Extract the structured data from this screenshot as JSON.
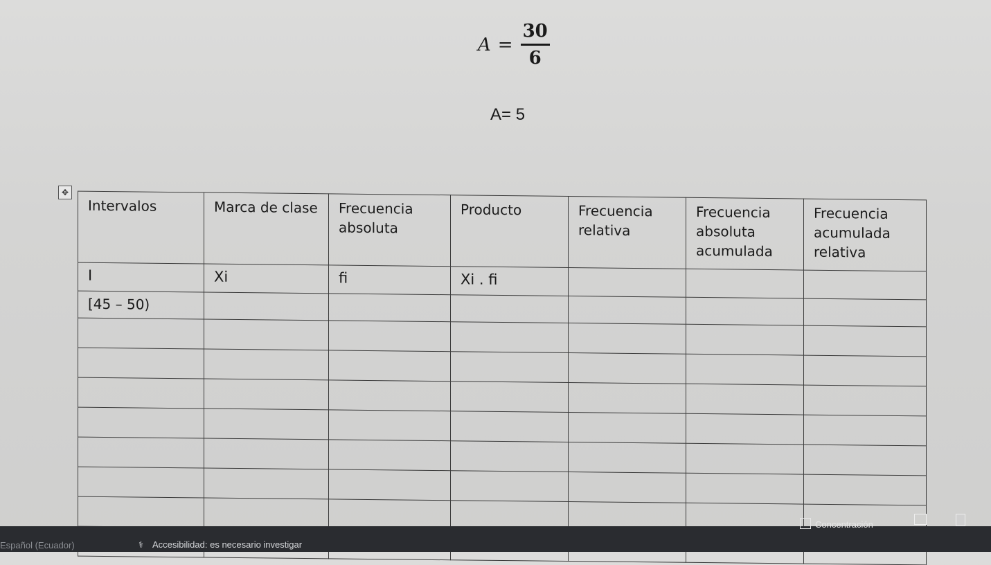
{
  "formula": {
    "lhs": "A",
    "equals": "=",
    "numerator": "30",
    "denominator": "6",
    "result": "A= 5"
  },
  "table": {
    "move_handle_icon": "move-handle-icon",
    "headers": [
      "Intervalos",
      "Marca de clase",
      "Frecuencia absoluta",
      "Producto",
      "Frecuencia relativa",
      "Frecuencia absoluta acumulada",
      "Frecuencia acumulada relativa"
    ],
    "subheaders": [
      "I",
      "Xi",
      "fi",
      "Xi . fi",
      "",
      "",
      ""
    ],
    "first_row": [
      "[45 – 50)",
      "",
      "",
      "",
      "",
      "",
      ""
    ],
    "empty_rows": 8
  },
  "statusbar": {
    "language": "Español (Ecuador)",
    "accessibility": "Accesibilidad: es necesario investigar",
    "focus": "Concentración"
  }
}
